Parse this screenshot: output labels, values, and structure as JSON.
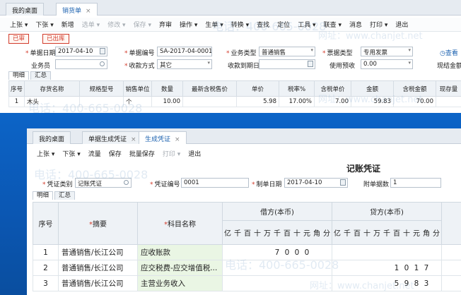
{
  "top": {
    "tabs": [
      {
        "label": "我的桌面"
      },
      {
        "label": "销货单",
        "close": "×"
      }
    ],
    "toolbar": [
      "上张 ▾",
      "下张 ▾",
      "新增",
      "选单 ▾",
      "修改 ▾",
      "保存 ▾",
      "弃审",
      "操作 ▾",
      "生单 ▾",
      "转换 ▾",
      "查找",
      "定位",
      "工具 ▾",
      "联查 ▾",
      "消息",
      "打印 ▾",
      "退出"
    ],
    "stamps": [
      "已审",
      "已出库"
    ],
    "form": {
      "date_label": "单据日期",
      "date_value": "2017-04-10",
      "no_label": "单据编号",
      "no_value": "SA-2017-04-0001",
      "biztype_label": "业务类型",
      "biztype_value": "普通销售",
      "invtype_label": "票据类型",
      "invtype_value": "专用发票",
      "view_link": "查看",
      "salesman_label": "业务员",
      "paymode_label": "收款方式",
      "paymode_value": "其它",
      "duedate_label": "收款到期日",
      "prepay_label": "使用预收",
      "prepay_value": "0.00",
      "cash_label": "现结金额"
    },
    "detail_tabs": [
      "明细",
      "汇总"
    ],
    "grid": {
      "headers": [
        "序号",
        "存货名称",
        "规格型号",
        "销售单位",
        "数量",
        "最新含税售价",
        "单价",
        "税率%",
        "含税单价",
        "金额",
        "含税金额",
        "现存量"
      ],
      "rows": [
        [
          "1",
          "木头",
          "",
          "个",
          "10.00",
          "",
          "5.98",
          "17.00%",
          "7.00",
          "59.83",
          "70.00",
          ""
        ]
      ]
    }
  },
  "inner": {
    "tabs": [
      {
        "label": "我的桌面"
      },
      {
        "label": "单据生成凭证",
        "close": "×"
      },
      {
        "label": "生成凭证",
        "close": "×"
      }
    ],
    "toolbar": [
      "上张 ▾",
      "下张 ▾",
      "流量",
      "保存",
      "批量保存",
      "打印 ▾",
      "退出"
    ],
    "title": "记账凭证",
    "form": {
      "vtype_label": "凭证类别",
      "vtype_value": "记账凭证",
      "vno_label": "凭证编号",
      "vno_value": "0001",
      "mdate_label": "制单日期",
      "mdate_value": "2017-04-10",
      "att_label": "附单据数",
      "att_value": "1"
    },
    "detail_tabs": [
      "明细",
      "汇总"
    ],
    "grid": {
      "h_no": "序号",
      "h_summary": "摘要",
      "h_subject": "科目名称",
      "h_debit": "借方(本币)",
      "h_credit": "贷方(本币)",
      "digit_units": [
        "亿",
        "千",
        "百",
        "十",
        "万",
        "千",
        "百",
        "十",
        "元",
        "角",
        "分"
      ],
      "rows": [
        {
          "no": "1",
          "summary": "普通销售/长江公司",
          "subject": "应收账款",
          "debit": [
            "",
            "",
            "",
            "",
            "",
            "7",
            "0",
            "0",
            "0",
            "",
            ""
          ],
          "credit": [
            "",
            "",
            "",
            "",
            "",
            "",
            "",
            "",
            "",
            "",
            ""
          ]
        },
        {
          "no": "2",
          "summary": "普通销售/长江公司",
          "subject": "应交税费-应交增值税...",
          "debit": [
            "",
            "",
            "",
            "",
            "",
            "",
            "",
            "",
            "",
            "",
            ""
          ],
          "credit": [
            "",
            "",
            "",
            "",
            "",
            "",
            "1",
            "0",
            "1",
            "7",
            ""
          ]
        },
        {
          "no": "3",
          "summary": "普通销售/长江公司",
          "subject": "主营业务收入",
          "debit": [
            "",
            "",
            "",
            "",
            "",
            "",
            "",
            "",
            "",
            "",
            ""
          ],
          "credit": [
            "",
            "",
            "",
            "",
            "",
            "",
            "5",
            "9",
            "8",
            "3",
            ""
          ]
        }
      ]
    }
  },
  "watermark": {
    "phone": "电话：400-665-0028",
    "site": "网址：www.chanjet.net"
  },
  "colors": {
    "accent": "#1e63b0",
    "background_blue": "#0c64c7",
    "stamp_red": "#d23b2b",
    "subject_cell_green": "#eaf6e4"
  }
}
